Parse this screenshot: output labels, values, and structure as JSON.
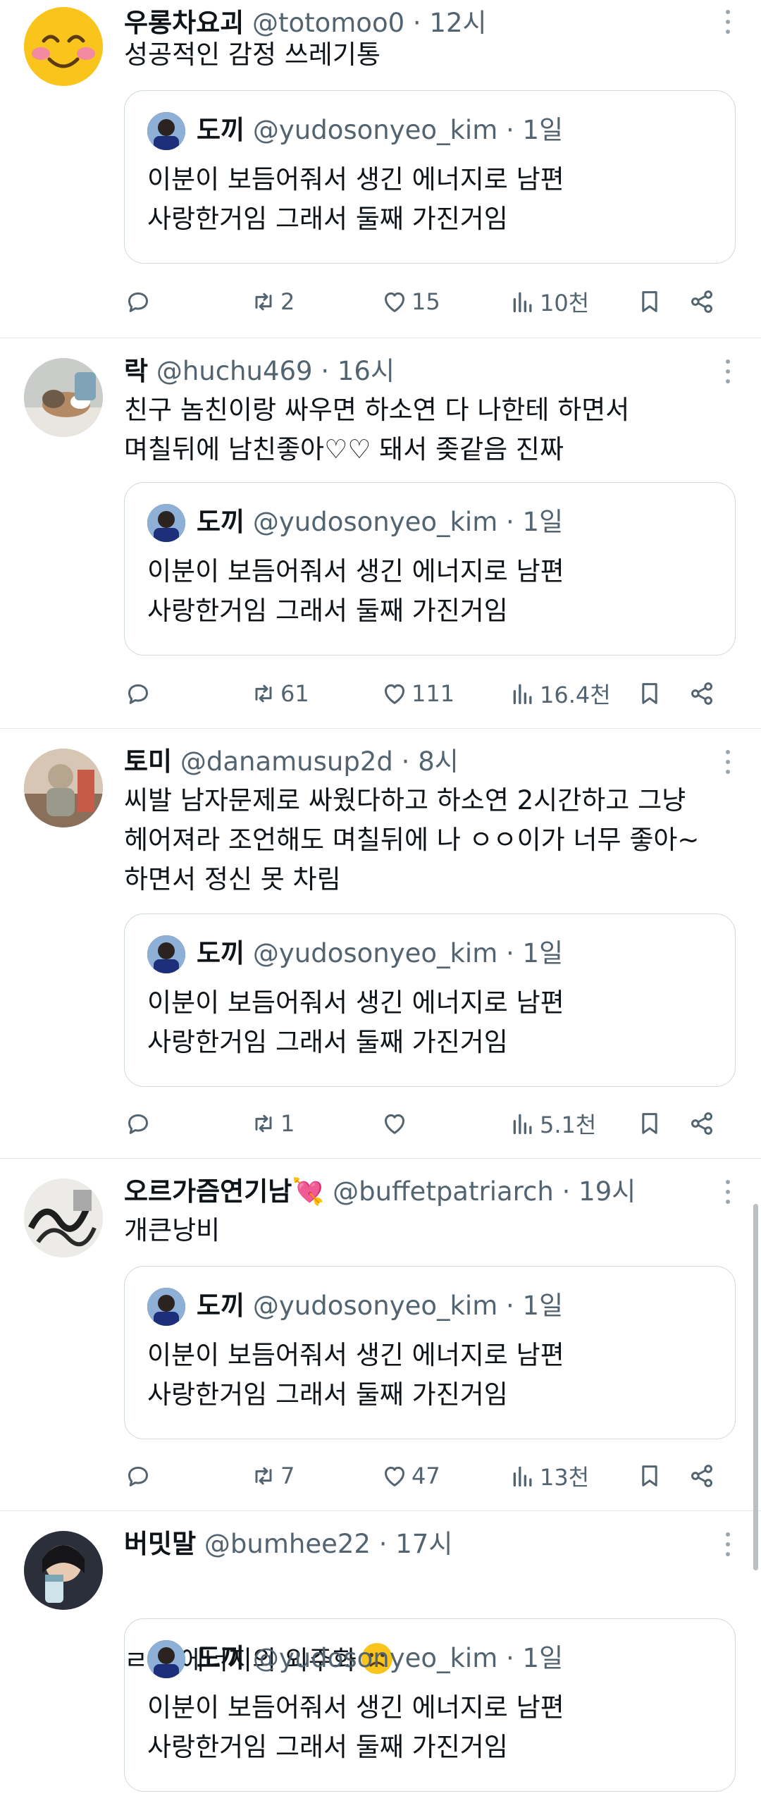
{
  "tweets": [
    {
      "name": "우롱차요괴",
      "handle": "@totomoo0",
      "time": "12시",
      "text": "성공적인 감정 쓰레기통",
      "inline_emoji": "",
      "avatar_icon": "smiling-face-emoji",
      "quote": {
        "name": "도끼",
        "handle": "@yudosonyeo_kim",
        "time": "1일",
        "text": "이분이 보듬어줘서 생긴 에너지로 남편\n사랑한거임 그래서 둘째 가진거임"
      },
      "stats": {
        "replies": "",
        "retweets": "2",
        "likes": "15",
        "views": "10천"
      }
    },
    {
      "name": "락",
      "handle": "@huchu469",
      "time": "16시",
      "text": "친구 놈친이랑 싸우면 하소연 다 나한테 하면서\n며칠뒤에 남친좋아♡♡ 돼서 좆같음 진짜",
      "inline_emoji": "",
      "avatar_icon": "cat-photo-avatar",
      "quote": {
        "name": "도끼",
        "handle": "@yudosonyeo_kim",
        "time": "1일",
        "text": "이분이 보듬어줘서 생긴 에너지로 남편\n사랑한거임 그래서 둘째 가진거임"
      },
      "stats": {
        "replies": "",
        "retweets": "61",
        "likes": "111",
        "views": "16.4천"
      }
    },
    {
      "name": "토미",
      "handle": "@danamusup2d",
      "time": "8시",
      "text": "씨발 남자문제로 싸웠다하고 하소연 2시간하고 그냥\n헤어져라 조언해도 며칠뒤에 나 ㅇㅇ이가 너무 좋아~\n하면서 정신 못 차림",
      "inline_emoji": "",
      "avatar_icon": "person-photo-avatar",
      "quote": {
        "name": "도끼",
        "handle": "@yudosonyeo_kim",
        "time": "1일",
        "text": "이분이 보듬어줘서 생긴 에너지로 남편\n사랑한거임 그래서 둘째 가진거임"
      },
      "stats": {
        "replies": "",
        "retweets": "1",
        "likes": "",
        "views": "5.1천"
      }
    },
    {
      "name": "오르가즘연기남",
      "name_emoji": "💘",
      "handle": "@buffetpatriarch",
      "time": "19시",
      "text": "개큰낭비",
      "inline_emoji": "",
      "avatar_icon": "sketch-art-avatar",
      "quote": {
        "name": "도끼",
        "handle": "@yudosonyeo_kim",
        "time": "1일",
        "text": "이분이 보듬어줘서 생긴 에너지로 남편\n사랑한거임 그래서 둘째 가진거임"
      },
      "stats": {
        "replies": "",
        "retweets": "7",
        "likes": "47",
        "views": "13천"
      }
    },
    {
      "name": "버밋말",
      "handle": "@bumhee22",
      "time": "17시",
      "text": "ㄹㅇ 에너지의 외주화",
      "inline_emoji": "slightly-frowning-face-emoji",
      "avatar_icon": "person-drinking-avatar",
      "quote": {
        "name": "도끼",
        "handle": "@yudosonyeo_kim",
        "time": "1일",
        "text": "이분이 보듬어줘서 생긴 에너지로 남편\n사랑한거임 그래서 둘째 가진거임"
      }
    }
  ],
  "separator": " · ",
  "colors": {
    "text": "#0f1419",
    "secondary": "#536471",
    "border": "#cfd9de",
    "divider": "#e6e9eb"
  }
}
